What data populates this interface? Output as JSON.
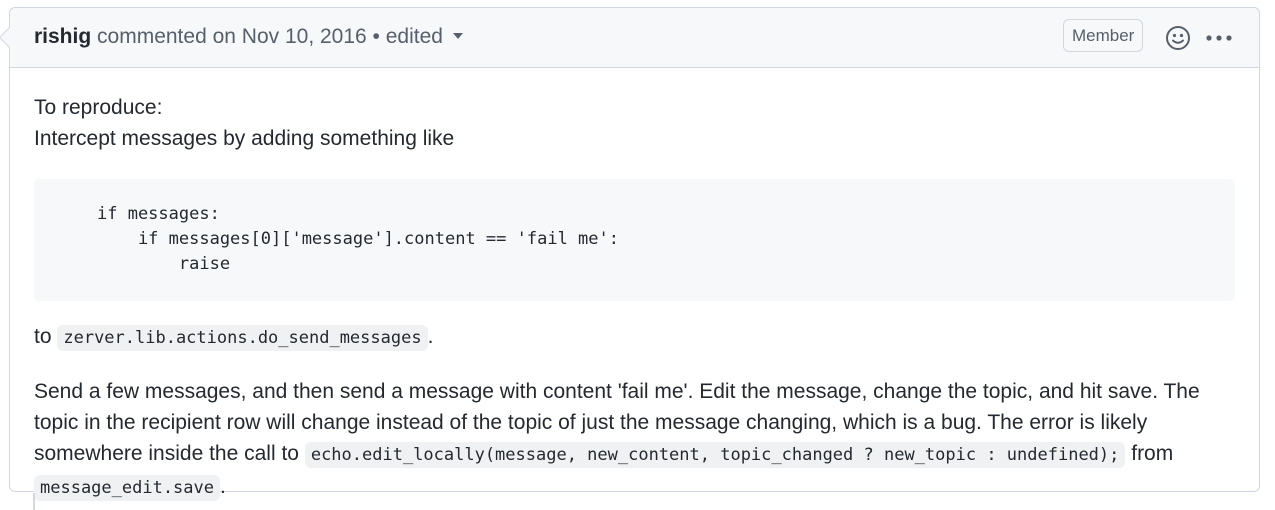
{
  "comment": {
    "author": "rishig",
    "action": "commented on Nov 10, 2016",
    "separator": "•",
    "edited_label": "edited",
    "badge": "Member",
    "icons": {
      "reaction": "smiley-icon",
      "menu": "kebab-horizontal-icon",
      "edited_dropdown": "triangle-down-icon"
    },
    "body": {
      "line1": "To reproduce:",
      "line2": "Intercept messages by adding something like",
      "code_lines": [
        "if messages:",
        "    if messages[0]['message'].content == 'fail me':",
        "        raise"
      ],
      "p1_prefix": "to",
      "p1_code": "zerver.lib.actions.do_send_messages",
      "p1_suffix": ".",
      "p2_text": "Send a few messages, and then send a message with content 'fail me'. Edit the message, change the topic, and hit save. The topic in the recipient row will change instead of the topic of just the message changing, which is a bug. The error is likely somewhere inside the call to",
      "p2_code1": "echo.edit_locally(message, new_content, topic_changed ? new_topic : undefined);",
      "p2_mid": "from",
      "p2_code2": "message_edit.save",
      "p2_end": "."
    }
  },
  "colors": {
    "header_bg": "#f6f8fa",
    "border": "#d0d7de",
    "text": "#24292f",
    "muted": "#57606a"
  }
}
